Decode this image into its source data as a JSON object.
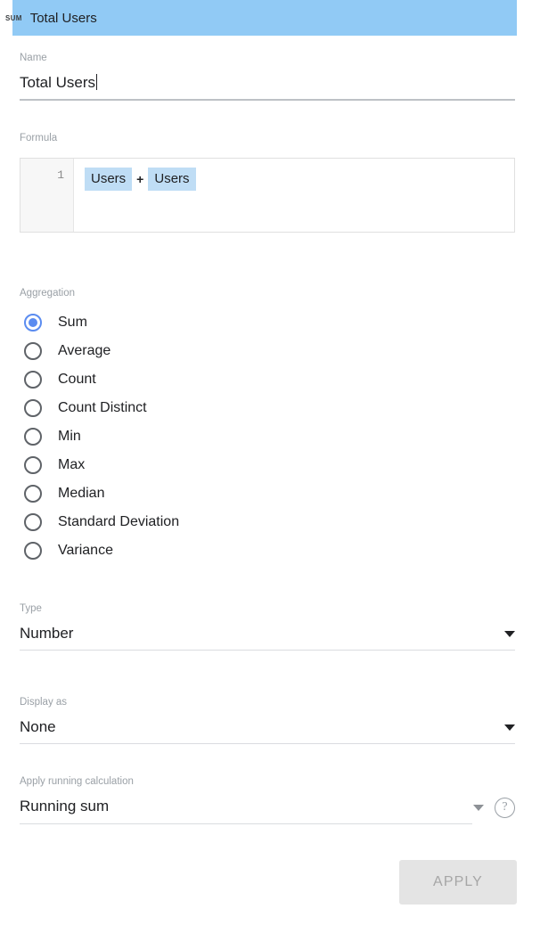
{
  "header": {
    "badge": "SUM",
    "title": "Total Users"
  },
  "name_field": {
    "label": "Name",
    "value": "Total Users"
  },
  "formula_field": {
    "label": "Formula",
    "line_number": "1",
    "tokens": [
      {
        "text": "Users",
        "kind": "field"
      },
      {
        "text": "+",
        "kind": "operator"
      },
      {
        "text": "Users",
        "kind": "field"
      }
    ]
  },
  "aggregation": {
    "label": "Aggregation",
    "selected": "Sum",
    "options": [
      "Sum",
      "Average",
      "Count",
      "Count Distinct",
      "Min",
      "Max",
      "Median",
      "Standard Deviation",
      "Variance"
    ]
  },
  "type_field": {
    "label": "Type",
    "value": "Number"
  },
  "display_as_field": {
    "label": "Display as",
    "value": "None"
  },
  "running_calculation_field": {
    "label": "Apply running calculation",
    "value": "Running sum",
    "help_glyph": "?"
  },
  "apply_button": {
    "label": "APPLY"
  },
  "colors": {
    "header_bg": "#91caf5",
    "accent": "#5b8cf0",
    "token_bg": "#bfddf5",
    "label_text": "#9aa0a6",
    "value_text": "#202124",
    "disabled_btn_bg": "#e4e4e4",
    "disabled_btn_text": "#a6a6a6"
  }
}
